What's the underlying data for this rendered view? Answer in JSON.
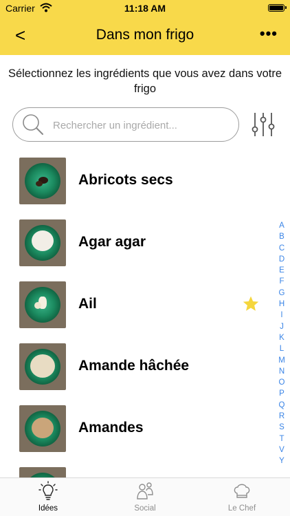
{
  "status": {
    "carrier": "Carrier",
    "time": "11:18 AM"
  },
  "nav": {
    "back": "<",
    "title": "Dans mon frigo",
    "more": "•••"
  },
  "subtitle": "Sélectionnez les ingrédients que vous avez dans votre frigo",
  "search": {
    "placeholder": "Rechercher un ingrédient..."
  },
  "items": [
    {
      "label": "Abricots secs",
      "favorite": false
    },
    {
      "label": "Agar agar",
      "favorite": false
    },
    {
      "label": "Ail",
      "favorite": true
    },
    {
      "label": "Amande hâchée",
      "favorite": false
    },
    {
      "label": "Amandes",
      "favorite": false
    }
  ],
  "alphabet": [
    "A",
    "B",
    "C",
    "D",
    "E",
    "F",
    "G",
    "H",
    "I",
    "J",
    "K",
    "L",
    "M",
    "N",
    "O",
    "P",
    "Q",
    "R",
    "S",
    "T",
    "V",
    "Y"
  ],
  "tabs": [
    {
      "label": "Idées",
      "icon": "bulb-icon",
      "active": true
    },
    {
      "label": "Social",
      "icon": "people-icon",
      "active": false
    },
    {
      "label": "Le Chef",
      "icon": "chef-hat-icon",
      "active": false
    }
  ],
  "colors": {
    "header": "#F8D94A",
    "accent_link": "#3a84e6",
    "star": "#F5D63D"
  }
}
